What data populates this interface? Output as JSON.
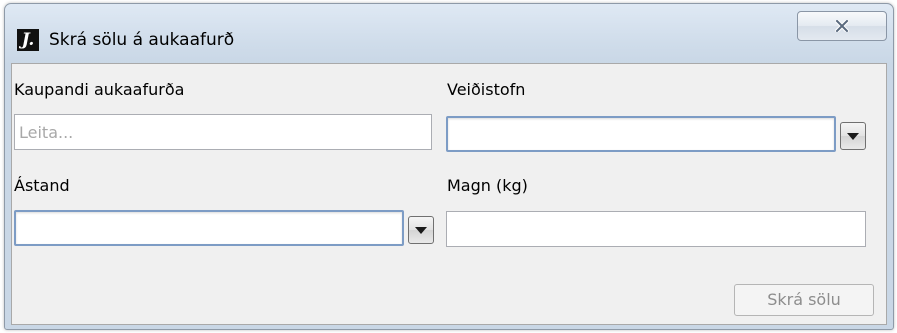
{
  "window": {
    "title": "Skrá sölu á aukaafurð",
    "icon_glyph": "J.",
    "icon_name": "app-logo-icon",
    "close_icon": "close-icon"
  },
  "form": {
    "buyer": {
      "label": "Kaupandi aukaafurða",
      "value": "",
      "placeholder": "Leita..."
    },
    "species": {
      "label": "Veiðistofn",
      "selected": ""
    },
    "condition": {
      "label": "Ástand",
      "selected": ""
    },
    "quantity": {
      "label": "Magn (kg)",
      "value": ""
    }
  },
  "actions": {
    "submit_label": "Skrá sölu",
    "submit_enabled": false
  },
  "colors": {
    "title_bar": "#cfdcea",
    "client_bg": "#f0f0f0",
    "focus_border": "#7d9cc5",
    "disabled_text": "#8d8d8d"
  }
}
